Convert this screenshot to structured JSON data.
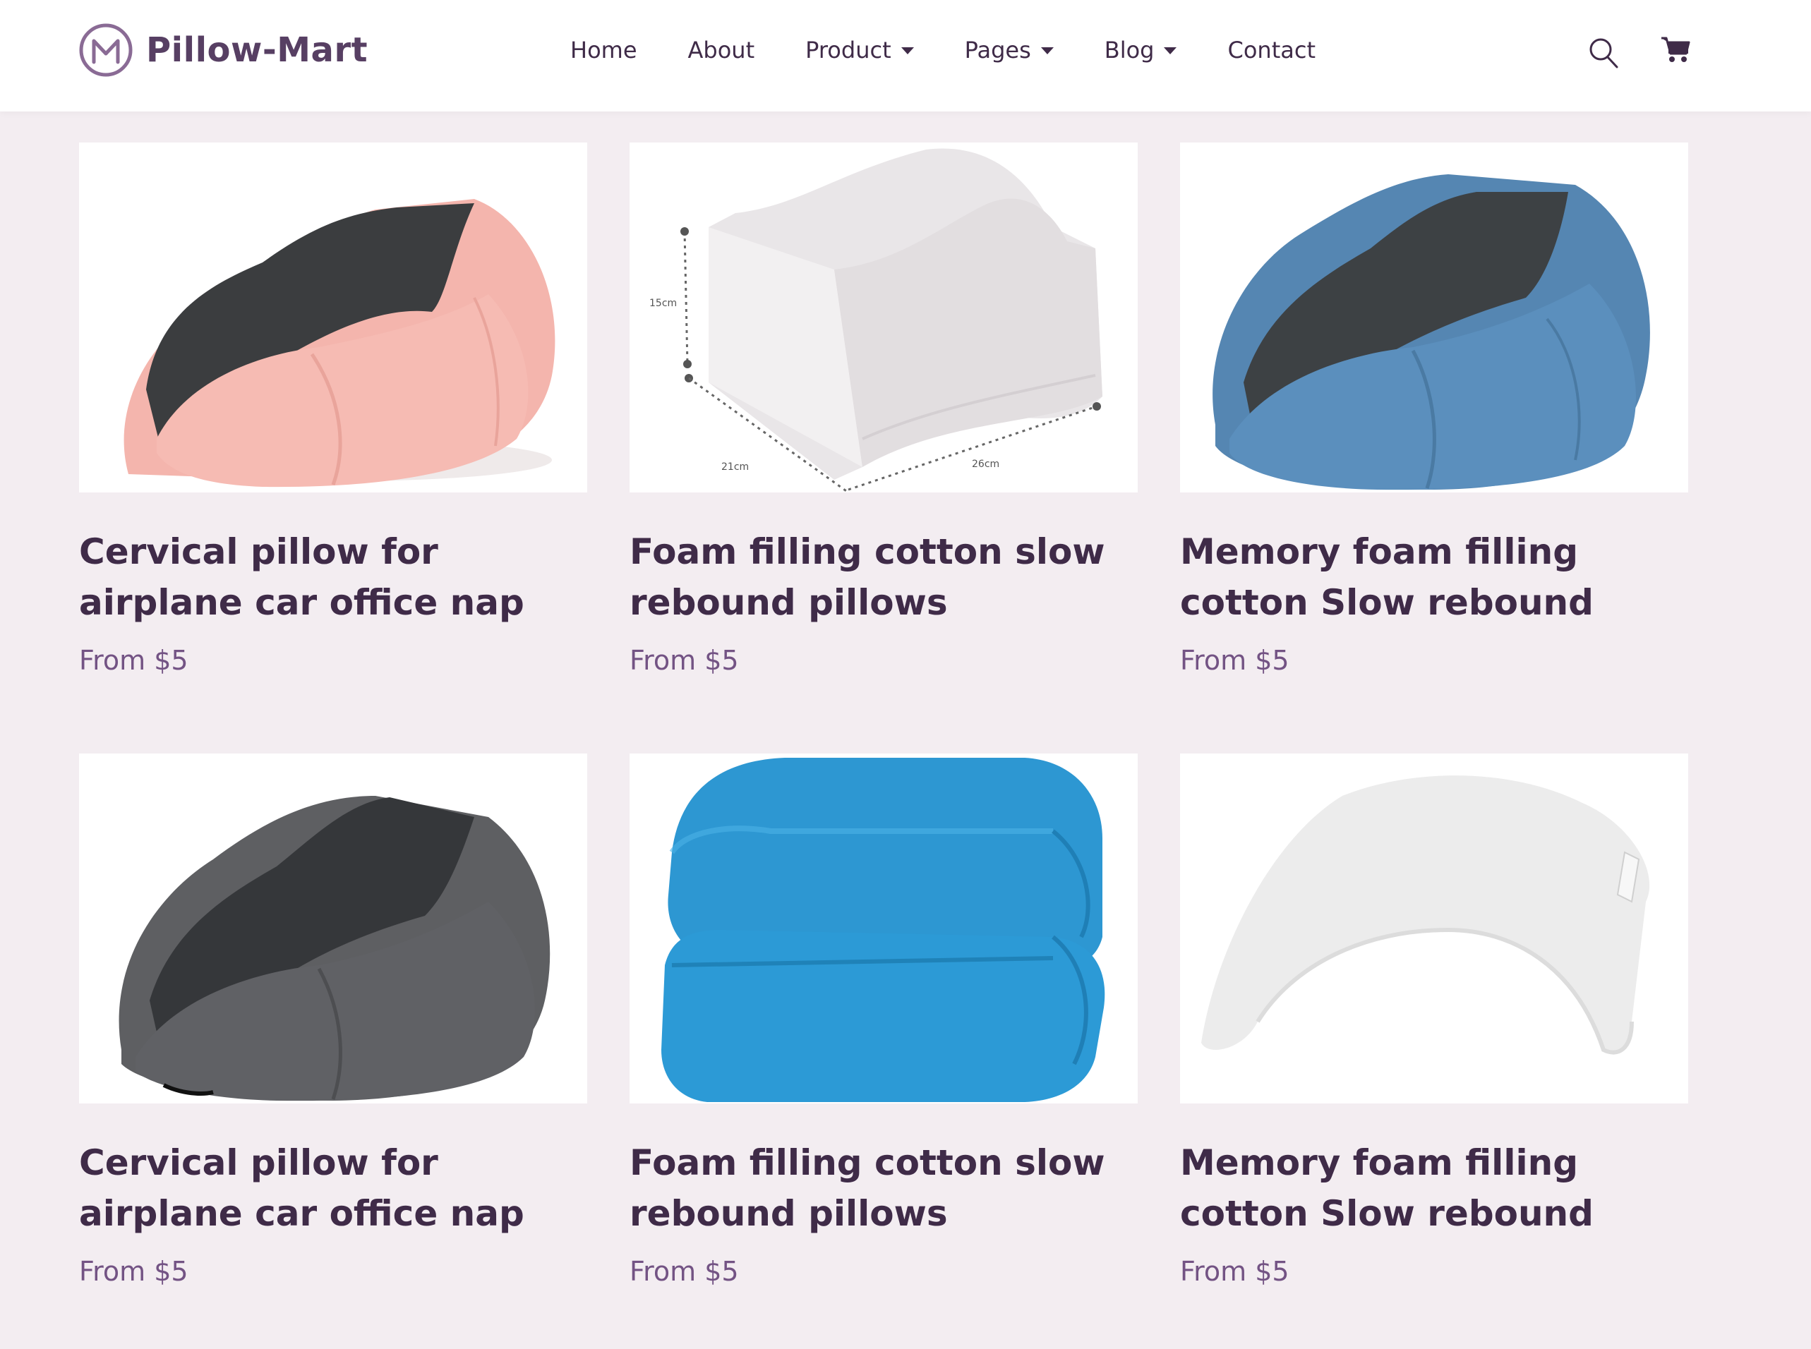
{
  "brand": {
    "name": "Pillow-Mart",
    "logo_icon": "m-circle-logo-icon",
    "accent_color": "#573f63"
  },
  "nav": {
    "items": [
      {
        "label": "Home",
        "dropdown": false
      },
      {
        "label": "About",
        "dropdown": false
      },
      {
        "label": "Product",
        "dropdown": true
      },
      {
        "label": "Pages",
        "dropdown": true
      },
      {
        "label": "Blog",
        "dropdown": true
      },
      {
        "label": "Contact",
        "dropdown": false
      }
    ]
  },
  "header_icons": {
    "search": "search-icon",
    "cart": "shopping-cart-icon"
  },
  "colors": {
    "page_background": "#f3edf1",
    "title_text": "#3f2b48",
    "price_text": "#735384"
  },
  "products": [
    {
      "title": "Cervical pillow for airplane car office nap pillow",
      "price": "From $5",
      "image": "pink-neck-pillow"
    },
    {
      "title": "Foam filling cotton slow rebound pillows",
      "price": "From $5",
      "image": "white-knee-pillow"
    },
    {
      "title": "Memory foam filling cotton Slow rebound pillows",
      "price": "From $5",
      "image": "blue-neck-pillow"
    },
    {
      "title": "Cervical pillow for airplane car office nap pillow",
      "price": "From $5",
      "image": "grey-neck-pillow"
    },
    {
      "title": "Foam filling cotton slow rebound pillows",
      "price": "From $5",
      "image": "folded-blue-blanket"
    },
    {
      "title": "Memory foam filling cotton Slow rebound pillows",
      "price": "From $5",
      "image": "white-arched-pillow"
    }
  ],
  "product_images": {
    "white-knee-pillow": {
      "dimension_labels": [
        "15cm",
        "21cm",
        "26cm"
      ]
    }
  }
}
